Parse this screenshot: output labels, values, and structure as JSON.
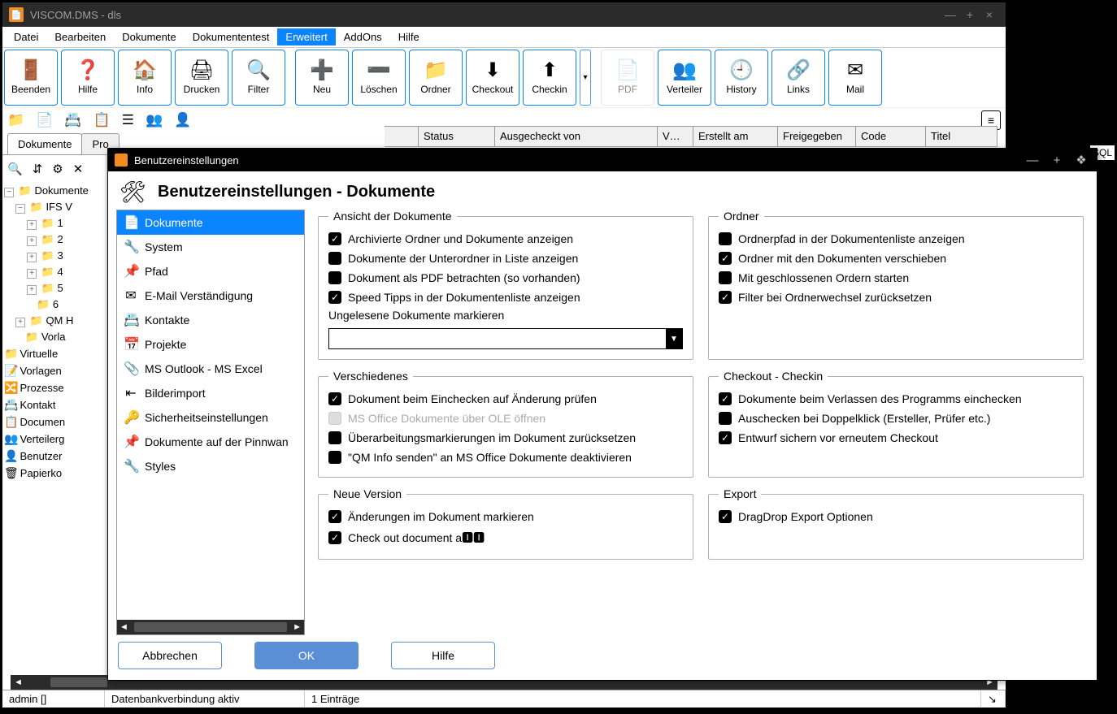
{
  "window": {
    "title": "VISCOM.DMS - dls",
    "menu": [
      "Datei",
      "Bearbeiten",
      "Dokumente",
      "Dokumententest",
      "Erweitert",
      "AddOns",
      "Hilfe"
    ],
    "menu_hi_index": 4,
    "toolbar": [
      {
        "label": "Beenden",
        "icon": "🚪"
      },
      {
        "label": "Hilfe",
        "icon": "❓"
      },
      {
        "label": "Info",
        "icon": "🏠"
      },
      {
        "label": "Drucken",
        "icon": "🖨"
      },
      {
        "label": "Filter",
        "icon": "🔍"
      }
    ],
    "toolbar2": [
      {
        "label": "Neu",
        "icon": "➕"
      },
      {
        "label": "Löschen",
        "icon": "➖"
      },
      {
        "label": "Ordner",
        "icon": "📁"
      },
      {
        "label": "Checkout",
        "icon": "⬇"
      },
      {
        "label": "Checkin",
        "icon": "⬆"
      }
    ],
    "toolbar3": [
      {
        "label": "PDF",
        "icon": "📄",
        "disabled": true
      },
      {
        "label": "Verteiler",
        "icon": "👥"
      },
      {
        "label": "History",
        "icon": "🕘"
      },
      {
        "label": "Links",
        "icon": "🔗"
      },
      {
        "label": "Mail",
        "icon": "✉"
      }
    ],
    "columns": [
      "Status",
      "Ausgecheckt von",
      "V…",
      "Erstellt am",
      "Freigegeben",
      "Code",
      "Titel"
    ],
    "tabs": [
      "Dokumente",
      "Pro"
    ],
    "active_tab": 0,
    "tree": {
      "root": "Dokumente",
      "items": [
        {
          "label": "IFS V"
        },
        {
          "label": "1"
        },
        {
          "label": "2"
        },
        {
          "label": "3"
        },
        {
          "label": "4"
        },
        {
          "label": "5"
        },
        {
          "label": "6"
        },
        {
          "label": "QM H",
          "red": true
        },
        {
          "label": "Vorla"
        }
      ],
      "bottom": [
        {
          "label": "Virtuelle",
          "icon": "📁"
        },
        {
          "label": "Vorlagen",
          "icon": "📝"
        },
        {
          "label": "Prozesse",
          "icon": "⚙"
        },
        {
          "label": "Kontakt",
          "icon": "📇"
        },
        {
          "label": "Documen",
          "icon": "📋"
        },
        {
          "label": "Verteilerg",
          "icon": "👥"
        },
        {
          "label": "Benutzer",
          "icon": "👤"
        },
        {
          "label": "Papierko",
          "icon": "🗑"
        }
      ]
    },
    "status": {
      "user": "admin []",
      "db": "Datenbankverbindung aktiv",
      "count": "1 Einträge"
    },
    "sql_badge": "SQL"
  },
  "dialog": {
    "title": "Benutzereinstellungen",
    "heading": "Benutzereinstellungen - Dokumente",
    "nav": [
      {
        "label": "Dokumente",
        "icon": "📄",
        "active": true
      },
      {
        "label": "System",
        "icon": "🔧"
      },
      {
        "label": "Pfad",
        "icon": "📌"
      },
      {
        "label": "E-Mail Verständigung",
        "icon": "✉"
      },
      {
        "label": "Kontakte",
        "icon": "📇"
      },
      {
        "label": "Projekte",
        "icon": "📅"
      },
      {
        "label": "MS Outlook - MS Excel",
        "icon": "📎"
      },
      {
        "label": "Bilderimport",
        "icon": "⇤"
      },
      {
        "label": "Sicherheitseinstellungen",
        "icon": "🔑"
      },
      {
        "label": "Dokumente auf der Pinnwan",
        "icon": "📌"
      },
      {
        "label": "Styles",
        "icon": "🔧"
      }
    ],
    "groups": {
      "ansicht": {
        "legend": "Ansicht der Dokumente",
        "items": [
          {
            "label": "Archivierte Ordner und Dokumente anzeigen",
            "checked": true
          },
          {
            "label": "Dokumente der Unterordner in Liste anzeigen",
            "checked": false
          },
          {
            "label": "Dokument als PDF betrachten (so vorhanden)",
            "checked": false
          },
          {
            "label": "Speed Tipps in der Dokumentenliste anzeigen",
            "checked": true
          }
        ],
        "extra_label": "Ungelesene Dokumente markieren",
        "combo_value": ""
      },
      "ordner": {
        "legend": "Ordner",
        "items": [
          {
            "label": "Ordnerpfad in der Dokumentenliste anzeigen",
            "checked": false
          },
          {
            "label": "Ordner mit den Dokumenten verschieben",
            "checked": true
          },
          {
            "label": "Mit geschlossenen Ordern starten",
            "checked": false
          },
          {
            "label": "Filter bei Ordnerwechsel zurücksetzen",
            "checked": true
          }
        ]
      },
      "versch": {
        "legend": "Verschiedenes",
        "items": [
          {
            "label": "Dokument beim Einchecken auf Änderung prüfen",
            "checked": true
          },
          {
            "label": "MS Office Dokumente über OLE öffnen",
            "checked": false,
            "disabled": true
          },
          {
            "label": "Überarbeitungsmarkierungen im Dokument zurücksetzen",
            "checked": false
          },
          {
            "label": "\"QM Info senden\" an MS Office Dokumente deaktivieren",
            "checked": false
          }
        ]
      },
      "checkout": {
        "legend": "Checkout - Checkin",
        "items": [
          {
            "label": "Dokumente beim Verlassen des Programms einchecken",
            "checked": true
          },
          {
            "label": "Auschecken bei Doppelklick (Ersteller, Prüfer etc.)",
            "checked": false
          },
          {
            "label": "Entwurf sichern vor erneutem Checkout",
            "checked": true
          }
        ]
      },
      "neuever": {
        "legend": "Neue Version",
        "items": [
          {
            "label": "Änderungen im Dokument markieren",
            "checked": true
          },
          {
            "label": "Check out document a🅸🅸",
            "checked": true
          }
        ]
      },
      "export": {
        "legend": "Export",
        "items": [
          {
            "label": "DragDrop Export Optionen",
            "checked": true
          }
        ]
      }
    },
    "buttons": {
      "cancel": "Abbrechen",
      "ok": "OK",
      "help": "Hilfe"
    }
  }
}
